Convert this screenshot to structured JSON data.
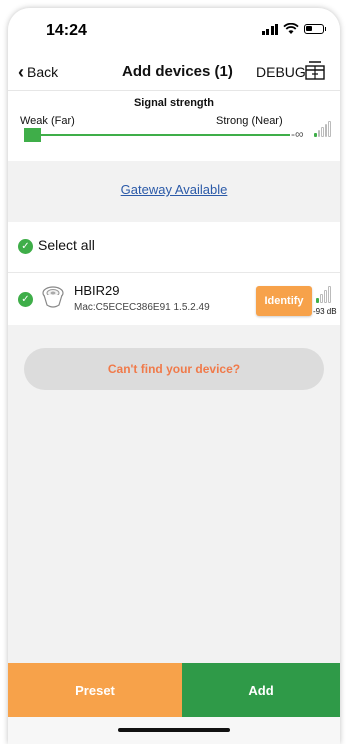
{
  "status_bar": {
    "time": "14:24"
  },
  "nav": {
    "back_label": "Back",
    "title": "Add devices (1)",
    "debug_label": "DEBUG",
    "gift_icon": "gift-icon"
  },
  "signal": {
    "title": "Signal strength",
    "weak_label": "Weak (Far)",
    "strong_label": "Strong (Near)",
    "filter_value": "-∞"
  },
  "gateway": {
    "label": "Gateway Available"
  },
  "select_all": {
    "label": "Select all",
    "checked": true
  },
  "devices": [
    {
      "name": "HBIR29",
      "mac_line": "Mac:C5ECEC386E91  1.5.2.49",
      "identify_label": "Identify",
      "rssi": "-93 dB",
      "checked": true
    }
  ],
  "cant_find": {
    "label": "Can't find your device?"
  },
  "footer": {
    "preset_label": "Preset",
    "add_label": "Add"
  },
  "colors": {
    "accent_green": "#3fae49",
    "orange": "#f7a24a",
    "link_blue": "#2b5aa8",
    "add_green": "#2f9a48"
  }
}
